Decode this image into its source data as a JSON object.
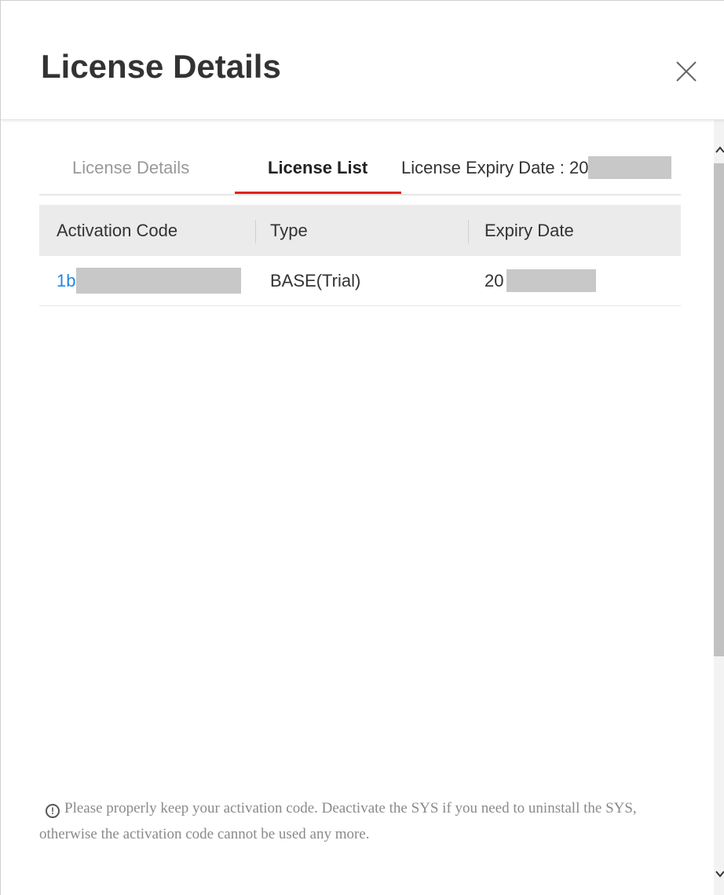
{
  "dialog": {
    "title": "License Details",
    "close_icon": "close-icon"
  },
  "tabs": [
    {
      "label": "License Details",
      "active": false
    },
    {
      "label": "License List",
      "active": true
    }
  ],
  "expiry": {
    "label": "License Expiry Date : 20"
  },
  "table": {
    "columns": [
      "Activation Code",
      "Type",
      "Expiry Date"
    ],
    "rows": [
      {
        "code": "1b",
        "type": "BASE(Trial)",
        "expiry": "20"
      }
    ]
  },
  "notice": {
    "icon": "info-circle-icon",
    "text": "Please properly keep your activation code. Deactivate the SYS if you need to uninstall the SYS, otherwise the activation code cannot be used any more."
  },
  "colors": {
    "accent": "#e2231a",
    "link": "#1e88e5",
    "header_bg": "#ebebeb",
    "redaction": "#c8c8c8"
  }
}
